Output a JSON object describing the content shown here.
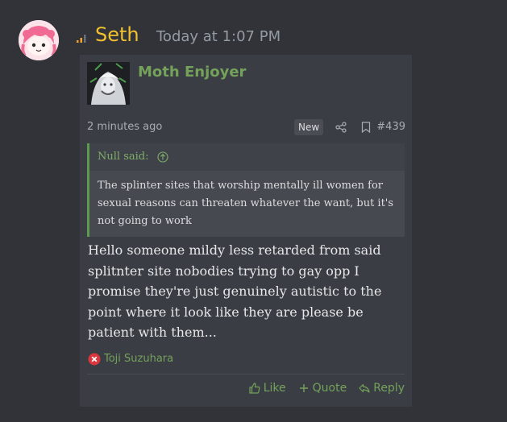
{
  "message": {
    "author": "Seth",
    "timestamp": "Today at 1:07 PM",
    "author_color": "#f2c12e"
  },
  "embed": {
    "thread_user": "Moth Enjoyer",
    "post_time": "2 minutes ago",
    "badge": "New",
    "post_number": "#439",
    "quote": {
      "author_line": "Null said:",
      "text": "The splinter sites that worship mentally ill women for sexual reasons can threaten whatever the want, but it's not going to work"
    },
    "body": "Hello someone mildy less retarded from said splitnter site nobodies trying to gay opp I promise they're just genuinely autistic to the point where it look like they are please be patient with them...",
    "reaction": {
      "icon": "x-circle-icon",
      "user": "Toji Suzuhara"
    },
    "actions": {
      "like": "Like",
      "quote": "Quote",
      "reply": "Reply"
    },
    "accent_color": "#74a25a"
  }
}
